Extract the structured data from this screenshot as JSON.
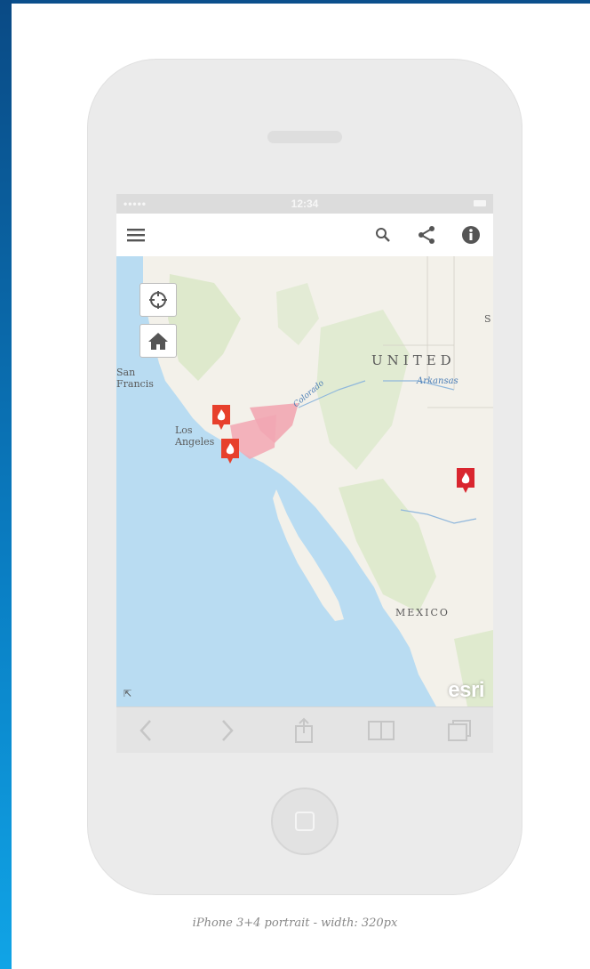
{
  "status_bar": {
    "signal": "•••••",
    "time": "12:34"
  },
  "app_bar": {
    "menu_icon": "hamburger-menu-icon",
    "search_icon": "search-icon",
    "share_icon": "share-icon",
    "info_icon": "info-icon"
  },
  "map": {
    "labels": {
      "country_us": "UNITED",
      "country_mx": "MEXICO",
      "states_fragment": "S",
      "city_sf": "San\nFrancis",
      "city_la": "Los\nAngeles",
      "river_ark": "Arkansas",
      "river_col": "Colorado"
    },
    "controls": {
      "locate_icon": "locate-crosshair-icon",
      "home_icon": "home-icon"
    },
    "fire_markers": [
      "fire-marker-icon",
      "fire-marker-icon",
      "fire-marker-icon"
    ],
    "attribution": "esri",
    "colors": {
      "water": "#b9dcf2",
      "land": "#f3f1ea",
      "veg": "#d9e8c7",
      "fire_area": "#f2a7b3",
      "marker": "#e7402c"
    }
  },
  "browser_toolbar": {
    "back_icon": "back-chevron-icon",
    "forward_icon": "forward-chevron-icon",
    "share_icon": "share-box-icon",
    "bookmarks_icon": "bookmarks-book-icon",
    "tabs_icon": "tabs-icon"
  },
  "caption": "iPhone 3+4 portrait - width: 320px"
}
